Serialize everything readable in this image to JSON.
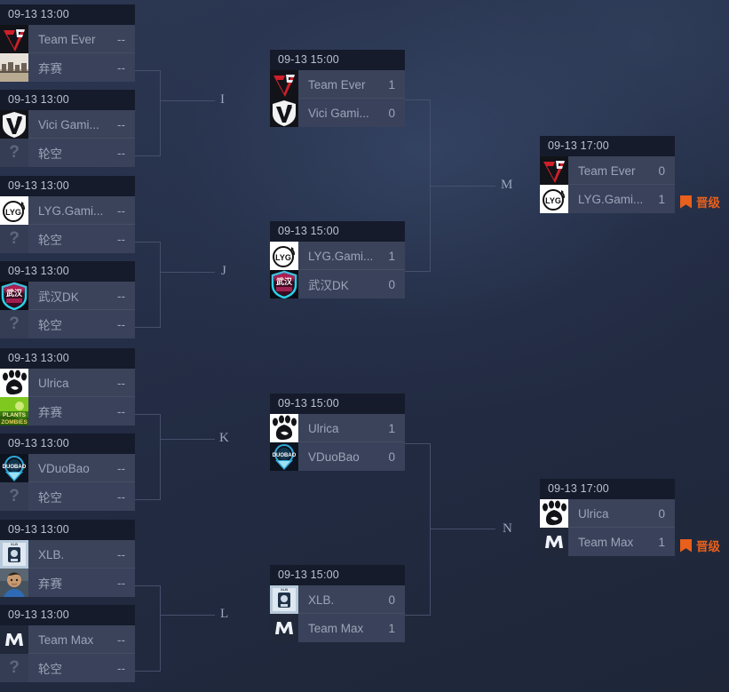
{
  "theme": {
    "background": "#242d45",
    "card_header_bg": "#151b2b",
    "team_row_bg": "#3a4359",
    "text_muted": "#9ba5b8",
    "connector": "#46506b",
    "accent_promote": "#e8601c"
  },
  "labels": {
    "promote_text": "晋级",
    "bye_text": "轮空",
    "forfeit_text": "弃赛",
    "empty_score": "--"
  },
  "round_letters": [
    {
      "id": "I",
      "text": "I"
    },
    {
      "id": "J",
      "text": "J"
    },
    {
      "id": "K",
      "text": "K"
    },
    {
      "id": "L",
      "text": "L"
    },
    {
      "id": "M",
      "text": "M"
    },
    {
      "id": "N",
      "text": "N"
    }
  ],
  "round1": [
    {
      "id": "r1-m1",
      "time": "09-13 13:00",
      "teams": [
        {
          "name": "Team Ever",
          "score": "--",
          "logo": "team-ever-logo"
        },
        {
          "name": "弃赛",
          "score": "--",
          "logo": "forfeit-photo-logo"
        }
      ]
    },
    {
      "id": "r1-m2",
      "time": "09-13 13:00",
      "teams": [
        {
          "name": "Vici Gami...",
          "score": "--",
          "logo": "vici-gaming-logo"
        },
        {
          "name": "轮空",
          "score": "--",
          "logo": "unknown-logo"
        }
      ]
    },
    {
      "id": "r1-m3",
      "time": "09-13 13:00",
      "teams": [
        {
          "name": "LYG.Gami...",
          "score": "--",
          "logo": "lyg-gaming-logo"
        },
        {
          "name": "轮空",
          "score": "--",
          "logo": "unknown-logo"
        }
      ]
    },
    {
      "id": "r1-m4",
      "time": "09-13 13:00",
      "teams": [
        {
          "name": "武汉DK",
          "score": "--",
          "logo": "wuhan-dk-logo"
        },
        {
          "name": "轮空",
          "score": "--",
          "logo": "unknown-logo"
        }
      ]
    },
    {
      "id": "r1-m5",
      "time": "09-13 13:00",
      "teams": [
        {
          "name": "Ulrica",
          "score": "--",
          "logo": "ulrica-logo"
        },
        {
          "name": "弃赛",
          "score": "--",
          "logo": "pvz-photo-logo"
        }
      ]
    },
    {
      "id": "r1-m6",
      "time": "09-13 13:00",
      "teams": [
        {
          "name": "VDuoBao",
          "score": "--",
          "logo": "vduobao-logo"
        },
        {
          "name": "轮空",
          "score": "--",
          "logo": "unknown-logo"
        }
      ]
    },
    {
      "id": "r1-m7",
      "time": "09-13 13:00",
      "teams": [
        {
          "name": "XLB.",
          "score": "--",
          "logo": "xlb-logo"
        },
        {
          "name": "弃赛",
          "score": "--",
          "logo": "player-photo-logo"
        }
      ]
    },
    {
      "id": "r1-m8",
      "time": "09-13 13:00",
      "teams": [
        {
          "name": "Team Max",
          "score": "--",
          "logo": "team-max-logo"
        },
        {
          "name": "轮空",
          "score": "--",
          "logo": "unknown-logo"
        }
      ]
    }
  ],
  "round2": [
    {
      "id": "r2-mI",
      "letter": "I",
      "time": "09-13 15:00",
      "teams": [
        {
          "name": "Team Ever",
          "score": "1",
          "logo": "team-ever-logo"
        },
        {
          "name": "Vici Gami...",
          "score": "0",
          "logo": "vici-gaming-logo"
        }
      ]
    },
    {
      "id": "r2-mJ",
      "letter": "J",
      "time": "09-13 15:00",
      "teams": [
        {
          "name": "LYG.Gami...",
          "score": "1",
          "logo": "lyg-gaming-logo"
        },
        {
          "name": "武汉DK",
          "score": "0",
          "logo": "wuhan-dk-logo"
        }
      ]
    },
    {
      "id": "r2-mK",
      "letter": "K",
      "time": "09-13 15:00",
      "teams": [
        {
          "name": "Ulrica",
          "score": "1",
          "logo": "ulrica-logo"
        },
        {
          "name": "VDuoBao",
          "score": "0",
          "logo": "vduobao-logo"
        }
      ]
    },
    {
      "id": "r2-mL",
      "letter": "L",
      "time": "09-13 15:00",
      "teams": [
        {
          "name": "XLB.",
          "score": "0",
          "logo": "xlb-logo"
        },
        {
          "name": "Team Max",
          "score": "1",
          "logo": "team-max-logo"
        }
      ]
    }
  ],
  "round3": [
    {
      "id": "r3-mM",
      "letter": "M",
      "time": "09-13 17:00",
      "promote": "晋级",
      "teams": [
        {
          "name": "Team Ever",
          "score": "0",
          "logo": "team-ever-logo"
        },
        {
          "name": "LYG.Gami...",
          "score": "1",
          "logo": "lyg-gaming-logo"
        }
      ]
    },
    {
      "id": "r3-mN",
      "letter": "N",
      "time": "09-13 17:00",
      "promote": "晋级",
      "teams": [
        {
          "name": "Ulrica",
          "score": "0",
          "logo": "ulrica-logo"
        },
        {
          "name": "Team Max",
          "score": "1",
          "logo": "team-max-logo"
        }
      ]
    }
  ]
}
